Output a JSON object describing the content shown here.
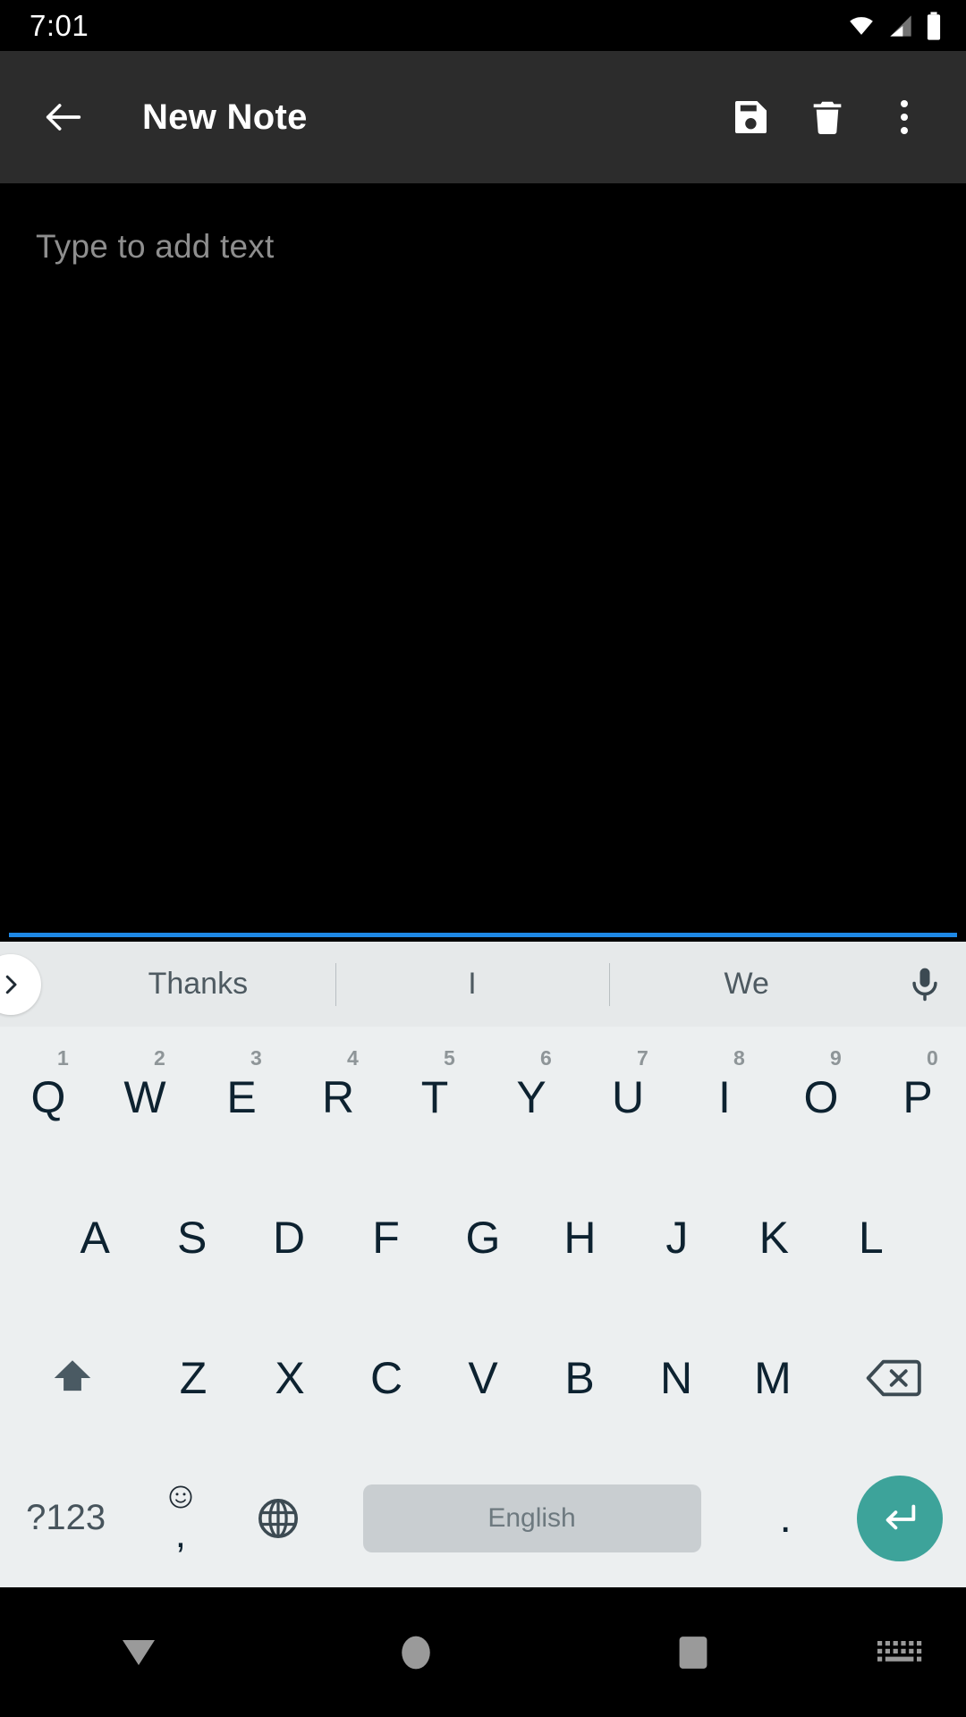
{
  "status_bar": {
    "time": "7:01",
    "icons": [
      "wifi-icon",
      "cellular-signal-icon",
      "battery-icon"
    ]
  },
  "app_bar": {
    "back_icon": "arrow-back-icon",
    "title": "New Note",
    "actions": [
      {
        "name": "save-button",
        "icon": "floppy-disk-save-icon"
      },
      {
        "name": "delete-button",
        "icon": "trash-icon"
      },
      {
        "name": "overflow-button",
        "icon": "more-vertical-icon"
      }
    ]
  },
  "editor": {
    "placeholder": "Type to add text",
    "value": "",
    "underline_color": "#1e88e5"
  },
  "suggestions": {
    "expand_icon": "chevron-right-icon",
    "items": [
      "Thanks",
      "I",
      "We"
    ],
    "mic_icon": "microphone-icon"
  },
  "keyboard": {
    "row1": [
      {
        "key": "Q",
        "hint": "1"
      },
      {
        "key": "W",
        "hint": "2"
      },
      {
        "key": "E",
        "hint": "3"
      },
      {
        "key": "R",
        "hint": "4"
      },
      {
        "key": "T",
        "hint": "5"
      },
      {
        "key": "Y",
        "hint": "6"
      },
      {
        "key": "U",
        "hint": "7"
      },
      {
        "key": "I",
        "hint": "8"
      },
      {
        "key": "O",
        "hint": "9"
      },
      {
        "key": "P",
        "hint": "0"
      }
    ],
    "row2": [
      "A",
      "S",
      "D",
      "F",
      "G",
      "H",
      "J",
      "K",
      "L"
    ],
    "row3": {
      "shift_icon": "shift-arrow-icon",
      "letters": [
        "Z",
        "X",
        "C",
        "V",
        "B",
        "N",
        "M"
      ],
      "backspace_icon": "backspace-icon"
    },
    "row4": {
      "symbols_label": "?123",
      "emoji_icon": "emoji-smiley-icon",
      "comma": ",",
      "globe_icon": "globe-language-icon",
      "space_label": "English",
      "period": ".",
      "enter_icon": "enter-return-icon",
      "enter_color": "#3da39a"
    }
  },
  "nav_bar": {
    "back_icon": "collapse-keyboard-triangle-icon",
    "home_icon": "home-circle-icon",
    "recents_icon": "recents-square-icon",
    "keyboard_switch_icon": "keyboard-switch-icon"
  }
}
